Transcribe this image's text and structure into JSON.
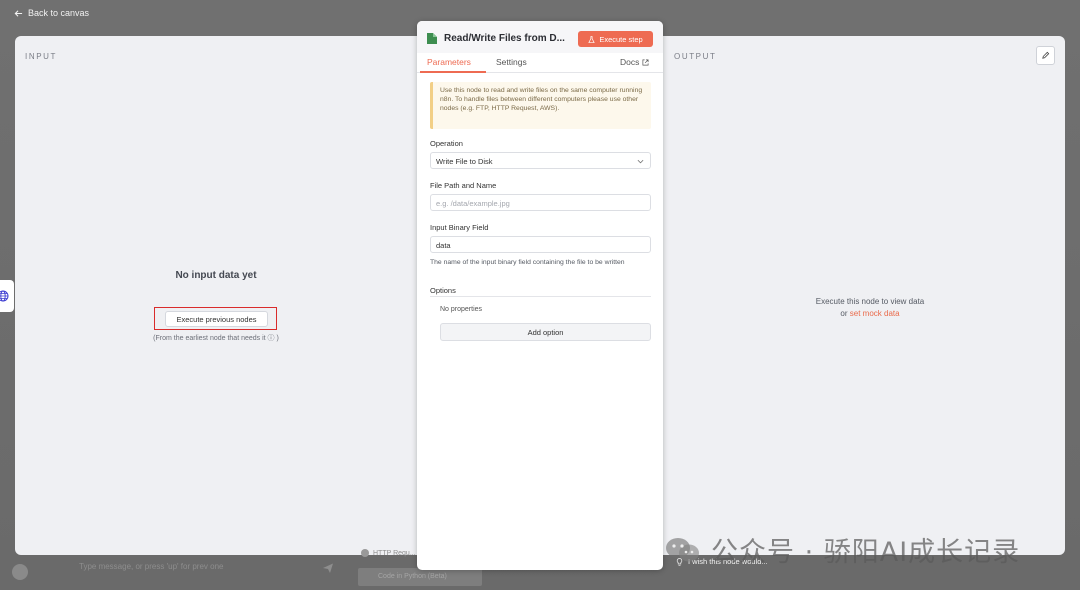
{
  "topbar": {
    "back_label": "Back to canvas"
  },
  "input_panel": {
    "label": "INPUT",
    "title": "No input data yet",
    "exec_prev_label": "Execute previous nodes",
    "exec_prev_hint": "(From the earliest node that needs it ⓘ )"
  },
  "output_panel": {
    "label": "OUTPUT",
    "line1": "Execute this node to view data",
    "line2_prefix": "or ",
    "mock_link": "set mock data"
  },
  "modal": {
    "title": "Read/Write Files from D...",
    "execute_label": "Execute step",
    "tabs": {
      "parameters": "Parameters",
      "settings": "Settings",
      "docs": "Docs"
    },
    "notice": "Use this node to read and write files on the same computer running n8n. To handle files between different computers please use other nodes (e.g. FTP, HTTP Request, AWS).",
    "operation": {
      "label": "Operation",
      "value": "Write File to Disk"
    },
    "file_path": {
      "label": "File Path and Name",
      "placeholder": "e.g. /data/example.jpg"
    },
    "binary_field": {
      "label": "Input Binary Field",
      "value": "data",
      "hint": "The name of the input binary field containing the file to be written"
    },
    "options": {
      "label": "Options",
      "empty": "No properties",
      "add_label": "Add option"
    }
  },
  "feedback": {
    "label": "I wish this node would..."
  },
  "chat": {
    "placeholder": "Type message, or press 'up' for prev one"
  },
  "background_nodes": {
    "node_a": "HTTP Requ...",
    "node_b": "Code in Python (Beta)"
  },
  "watermark": {
    "text": "公众号 · 骄阳AI成长记录"
  },
  "colors": {
    "accent": "#ee6b52",
    "highlight_frame": "#d92b2b",
    "notice_bg": "#fdf8ec"
  }
}
